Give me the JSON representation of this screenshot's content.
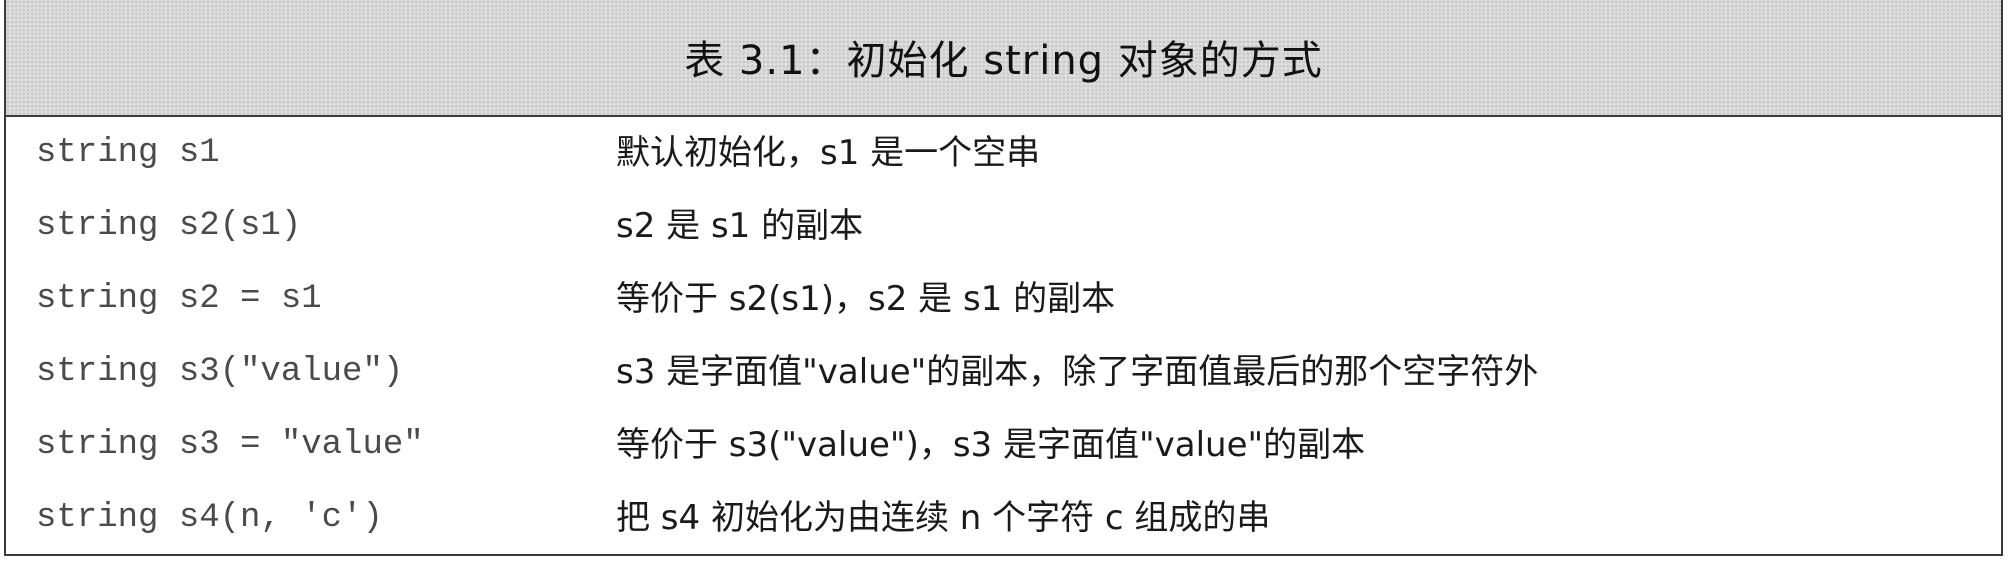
{
  "table": {
    "caption": "表 3.1：初始化 string 对象的方式",
    "rows": [
      {
        "code": "string s1",
        "description": "默认初始化，s1 是一个空串"
      },
      {
        "code": "string s2(s1)",
        "description": "s2 是 s1 的副本"
      },
      {
        "code": "string s2 = s1",
        "description": "等价于 s2(s1)，s2 是 s1 的副本"
      },
      {
        "code": "string s3(\"value\")",
        "description": "s3 是字面值\"value\"的副本，除了字面值最后的那个空字符外"
      },
      {
        "code": "string s3 = \"value\"",
        "description": "等价于 s3(\"value\")，s3 是字面值\"value\"的副本"
      },
      {
        "code": "string s4(n, 'c')",
        "description": "把 s4 初始化为由连续 n 个字符 c 组成的串"
      }
    ]
  }
}
